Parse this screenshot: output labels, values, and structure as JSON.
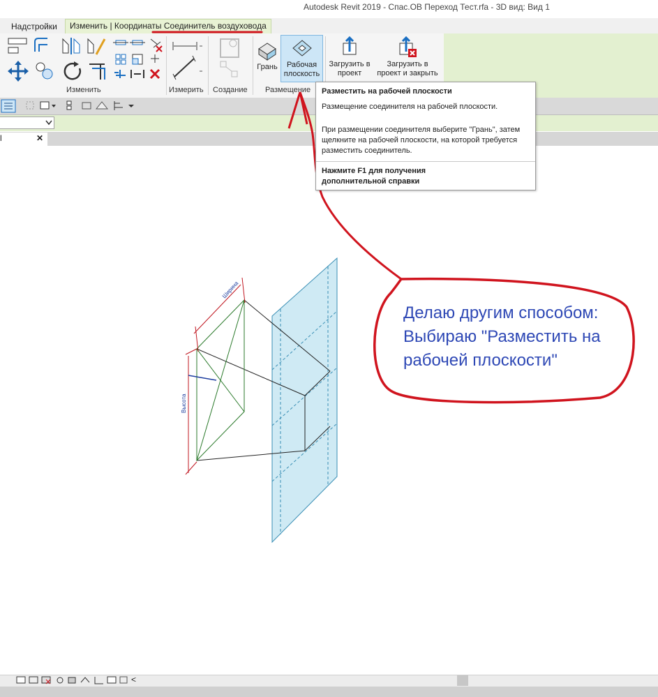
{
  "window": {
    "title": "Autodesk Revit 2019 - Спас.ОВ Переход Тест.rfa - 3D вид: Вид 1"
  },
  "ribbon_tabs": [
    {
      "label": "Надстройки"
    },
    {
      "label": "Изменить | Координаты Соединитель воздуховода"
    }
  ],
  "ribbon": {
    "panels": {
      "modify": "Изменить",
      "measure": "Измерить",
      "create": "Создание",
      "placement": "Размещение"
    },
    "buttons": {
      "face": "Грань",
      "workplane_line1": "Рабочая",
      "workplane_line2": "плоскость",
      "load_line1": "Загрузить в",
      "load_line2": "проект",
      "load_close_line1": "Загрузить в",
      "load_close_line2": "проект и закрыть"
    }
  },
  "view_tab": {
    "label": "l",
    "close": "✕"
  },
  "tooltip": {
    "title": "Разместить на рабочей плоскости",
    "description": "Размещение соединителя на рабочей плоскости.",
    "detail": "При размещении соединителя выберите \"Грань\", затем щелкните на рабочей плоскости, на которой требуется разместить соединитель.",
    "help": "Нажмите F1 для получения дополнительной справки"
  },
  "annotation": {
    "text_line1": "Делаю другим способом:",
    "text_line2": "Выбираю \"Разместить на",
    "text_line3": "рабочей плоскости\"",
    "color": "#d0141e"
  },
  "drawing": {
    "dimension_width": "Ширина",
    "dimension_height": "Высота"
  },
  "statusbar": {
    "scroll_left": "<"
  },
  "colors": {
    "ribbon_green": "#e3f0d0",
    "highlight_blue": "#cde6f7",
    "annotation_red": "#d0141e",
    "plane_fill": "#cfeaf4"
  }
}
